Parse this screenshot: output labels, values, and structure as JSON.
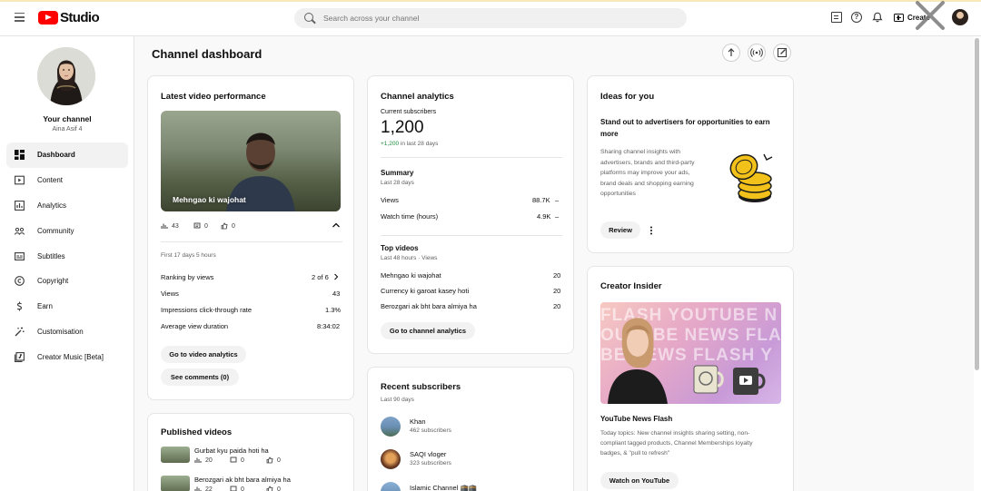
{
  "header": {
    "logo_text": "Studio",
    "search_placeholder": "Search across your channel",
    "create_label": "Create"
  },
  "sidebar": {
    "channel_title": "Your channel",
    "channel_name": "Aina Asif 4",
    "items": [
      {
        "label": "Dashboard",
        "icon": "dashboard-icon",
        "active": true
      },
      {
        "label": "Content",
        "icon": "content-icon"
      },
      {
        "label": "Analytics",
        "icon": "analytics-icon"
      },
      {
        "label": "Community",
        "icon": "community-icon"
      },
      {
        "label": "Subtitles",
        "icon": "subtitles-icon"
      },
      {
        "label": "Copyright",
        "icon": "copyright-icon"
      },
      {
        "label": "Earn",
        "icon": "earn-icon"
      },
      {
        "label": "Customisation",
        "icon": "customisation-icon"
      },
      {
        "label": "Creator Music [Beta]",
        "icon": "creator-music-icon"
      }
    ]
  },
  "page": {
    "title": "Channel dashboard"
  },
  "latest_video": {
    "title": "Latest video performance",
    "video_title": "Mehngao ki wajohat",
    "views": "43",
    "comments": "0",
    "likes": "0",
    "period": "First 17 days 5 hours",
    "rows": [
      {
        "label": "Ranking by views",
        "value": "2 of 6"
      },
      {
        "label": "Views",
        "value": "43"
      },
      {
        "label": "Impressions click-through rate",
        "value": "1.3%"
      },
      {
        "label": "Average view duration",
        "value": "8:34:02"
      }
    ],
    "analytics_button": "Go to video analytics",
    "comments_button": "See comments (0)"
  },
  "published": {
    "title": "Published videos",
    "videos": [
      {
        "title": "Gurbat kyu paida hoti ha",
        "views": "20",
        "comments": "0",
        "likes": "0"
      },
      {
        "title": "Berozgari ak bht bara almiya ha",
        "views": "22",
        "comments": "0",
        "likes": "0"
      }
    ]
  },
  "analytics": {
    "title": "Channel analytics",
    "subs_label": "Current subscribers",
    "subs_value": "1,200",
    "subs_change": "+1,200",
    "subs_change_suffix": "in last 28 days",
    "summary_title": "Summary",
    "summary_period": "Last 28 days",
    "summary_rows": [
      {
        "label": "Views",
        "value": "88.7K",
        "trend": "–"
      },
      {
        "label": "Watch time (hours)",
        "value": "4.9K",
        "trend": "–"
      }
    ],
    "top_title": "Top videos",
    "top_period": "Last 48 hours · Views",
    "top_videos": [
      {
        "title": "Mehngao ki wajohat",
        "views": "20"
      },
      {
        "title": "Currency ki garoat kasey hoti",
        "views": "20"
      },
      {
        "title": "Berozgari ak bht bara almiya ha",
        "views": "20"
      }
    ],
    "button": "Go to channel analytics"
  },
  "recent_subs": {
    "title": "Recent subscribers",
    "period": "Last 90 days",
    "subs": [
      {
        "name": "Khan",
        "count": "462 subscribers"
      },
      {
        "name": "SAQI vloger",
        "count": "323 subscribers"
      },
      {
        "name": "Islamic Channel 🕋🕋",
        "count": ""
      }
    ]
  },
  "ideas": {
    "title": "Ideas for you",
    "headline": "Stand out to advertisers for opportunities to earn more",
    "body_lines": [
      "Sharing channel insights with",
      "advertisers, brands and third-party",
      "platforms may improve your ads,",
      "brand deals and shopping earning",
      "opportunities"
    ],
    "button": "Review"
  },
  "insider": {
    "title": "Creator Insider",
    "image_text": [
      "FLASH YOUTUBE N",
      "OUTUBE NEWS FLA",
      "BE NEWS FLASH Y"
    ],
    "video_title": "YouTube News Flash",
    "body_lines": [
      "Today topics: New channel insights sharing setting, non-",
      "compliant tagged products, Channel Memberships loyalty",
      "badges, & \"pull to refresh\""
    ],
    "button": "Watch on YouTube"
  },
  "colors": {
    "brand_red": "#ff0000",
    "positive_green": "#1e8e3e",
    "coin_gold": "#f2c21a"
  }
}
